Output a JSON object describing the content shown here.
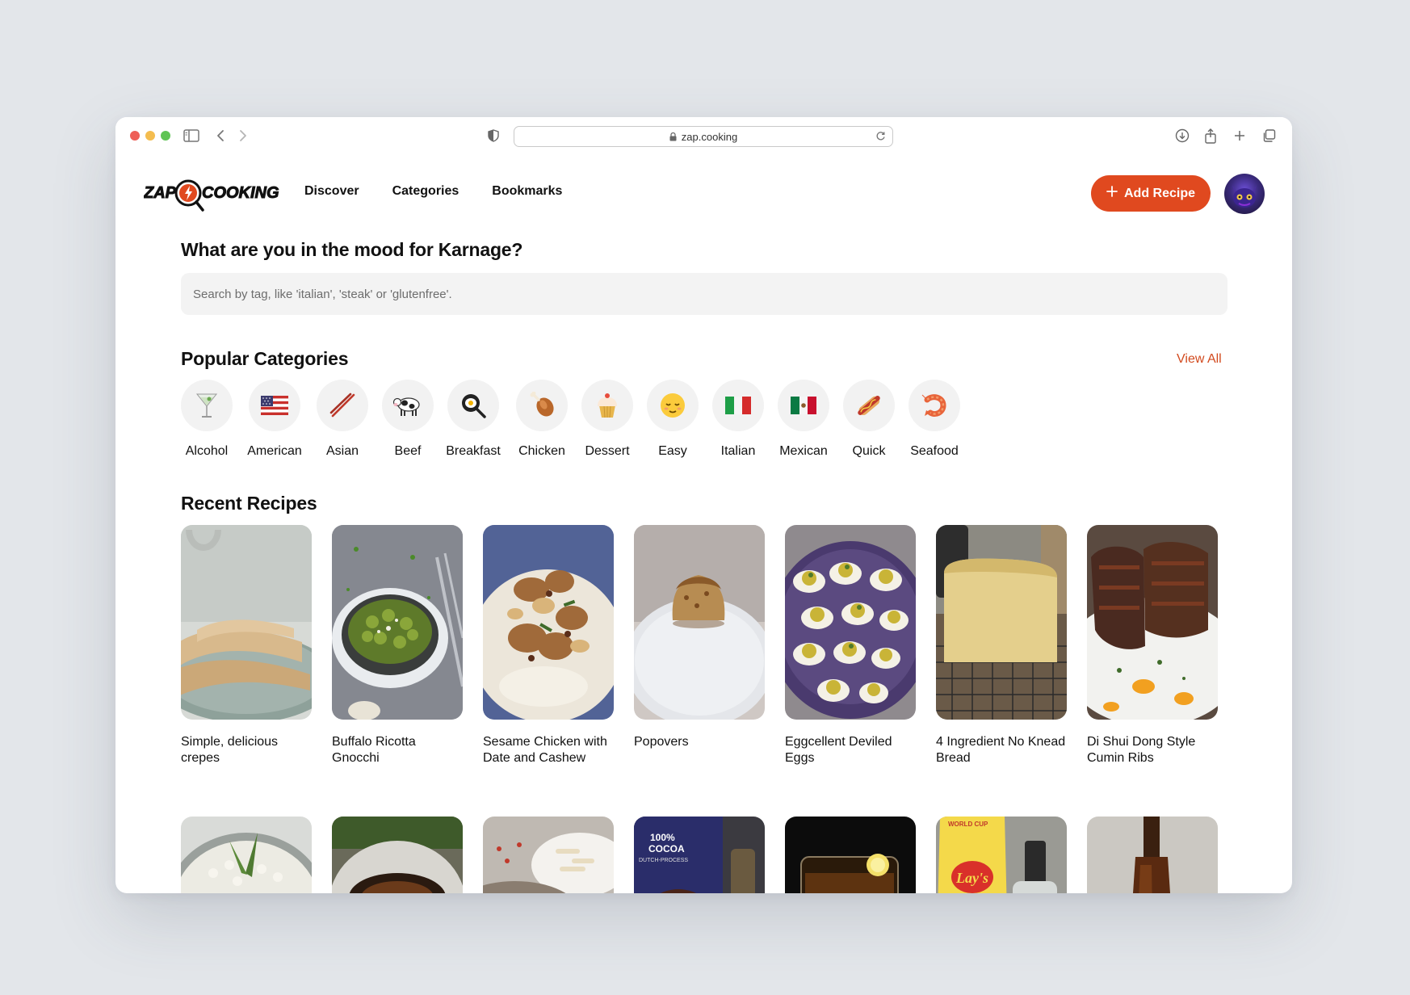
{
  "browser": {
    "url": "zap.cooking"
  },
  "header": {
    "logo_text": "ZAP COOKING",
    "nav": [
      {
        "label": "Discover"
      },
      {
        "label": "Categories"
      },
      {
        "label": "Bookmarks"
      }
    ],
    "add_recipe_label": "Add Recipe"
  },
  "main": {
    "greeting": "What are you in the mood for Karnage?",
    "search_placeholder": "Search by tag, like 'italian', 'steak' or 'glutenfree'.",
    "popular_title": "Popular Categories",
    "view_all_label": "View All",
    "categories": [
      {
        "label": "Alcohol",
        "icon": "cocktail-icon"
      },
      {
        "label": "American",
        "icon": "us-flag-icon"
      },
      {
        "label": "Asian",
        "icon": "chopsticks-icon"
      },
      {
        "label": "Beef",
        "icon": "cow-icon"
      },
      {
        "label": "Breakfast",
        "icon": "frying-pan-egg-icon"
      },
      {
        "label": "Chicken",
        "icon": "drumstick-icon"
      },
      {
        "label": "Dessert",
        "icon": "cupcake-icon"
      },
      {
        "label": "Easy",
        "icon": "relieved-face-icon"
      },
      {
        "label": "Italian",
        "icon": "italy-flag-icon"
      },
      {
        "label": "Mexican",
        "icon": "mexico-flag-icon"
      },
      {
        "label": "Quick",
        "icon": "hotdog-icon"
      },
      {
        "label": "Seafood",
        "icon": "shrimp-icon"
      }
    ],
    "recent_title": "Recent Recipes",
    "recipes": [
      {
        "title": "Simple, delicious crepes"
      },
      {
        "title": "Buffalo Ricotta Gnocchi"
      },
      {
        "title": "Sesame Chicken with Date and Cashew"
      },
      {
        "title": "Popovers"
      },
      {
        "title": "Eggcellent Deviled Eggs"
      },
      {
        "title": "4 Ingredient No Knead Bread"
      },
      {
        "title": "Di Shui Dong Style Cumin Ribs"
      }
    ]
  },
  "colors": {
    "accent": "#e0491f",
    "link": "#d24a1e"
  }
}
